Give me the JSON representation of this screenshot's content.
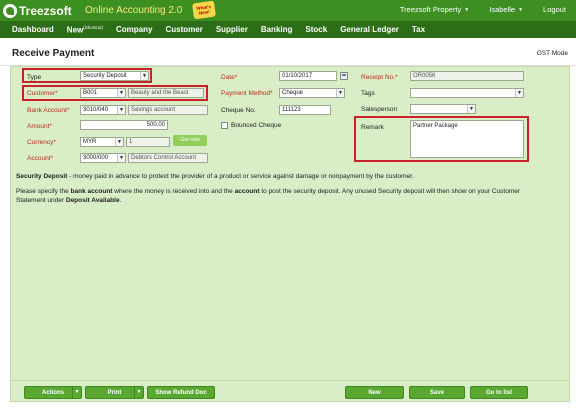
{
  "header": {
    "logo_text": "Treezsoft",
    "app_name": "Online Accounting 2.0",
    "whats_new": "What's New!",
    "company": "Treezsoft Property",
    "user": "Isabelle",
    "logout": "Logout"
  },
  "nav": {
    "items": [
      "Dashboard",
      "New",
      "Company",
      "Customer",
      "Supplier",
      "Banking",
      "Stock",
      "General Ledger",
      "Tax"
    ],
    "new_sup": "(Shortcut)"
  },
  "page": {
    "title": "Receive Payment",
    "gst_mode": "GST Mode"
  },
  "form": {
    "type_label": "Type",
    "type_value": "Security Deposit",
    "customer_label": "Customer*",
    "customer_code": "B001",
    "customer_name": "Beauty and the Beast",
    "bank_label": "Bank Account*",
    "bank_code": "3010/040",
    "bank_name": "Savings account",
    "amount_label": "Amount*",
    "amount_value": "500.00",
    "currency_label": "Currency*",
    "currency_value": "MYR",
    "rate_value": "1",
    "get_rate": "Get rate",
    "account_label": "Account*",
    "account_code": "3000/000",
    "account_name": "Debtors Control Account",
    "date_label": "Date*",
    "date_value": "01/10/2017",
    "method_label": "Payment Method*",
    "method_value": "Cheque",
    "cheque_label": "Cheque No.",
    "cheque_value": "111123",
    "bounced_label": "Bounced Cheque",
    "receipt_label": "Receipt No.*",
    "receipt_value": "OR0056",
    "tags_label": "Tags",
    "tags_value": "",
    "salesperson_label": "Salesperson",
    "salesperson_value": "",
    "remark_label": "Remark",
    "remark_value": "Partner Package"
  },
  "notes": {
    "p1_bold": "Security Deposit",
    "p1_rest": " - money paid in advance to protect the provider of a product or service against damage or nonpayment by the customer.",
    "p2_a": "Please specify the ",
    "p2_b": "bank account",
    "p2_c": " where the money is received into and the ",
    "p2_d": "account",
    "p2_e": " to post the security deposit. Any unused Security deposit will then show on your Customer Statement under ",
    "p2_f": "Deposit Available",
    "p2_g": "."
  },
  "buttons": {
    "actions": "Actions",
    "print": "Print",
    "show_refund": "Show Refund Doc",
    "new": "New",
    "save": "Save",
    "go_to_list": "Go to list"
  },
  "colors": {
    "header_green": "#3d8f22",
    "nav_green": "#2c6e17",
    "form_bg": "#d9edc6",
    "button_green": "#5aa832",
    "highlight_red": "#c9222b"
  }
}
